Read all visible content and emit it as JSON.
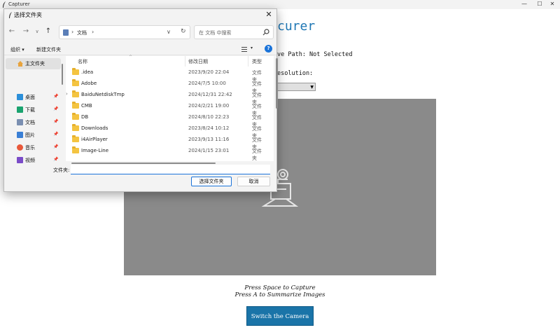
{
  "app": {
    "title": "Capturer",
    "heading_visible": "curer",
    "save_path_visible": "ve Path: Not Selected",
    "resolution_label_visible": "esolution:",
    "hint_capture": "Press Space to Capture",
    "hint_summarize": "Press A to Summarize Images",
    "switch_camera_label": "Switch the Camera",
    "controls": {
      "minimize": "—",
      "maximize": "☐",
      "close": "✕"
    },
    "accent_color": "#1a74a8",
    "camera_icon": "camera-icon"
  },
  "dialog": {
    "title": "选择文件夹",
    "close": "✕",
    "nav": {
      "back": "←",
      "forward": "→",
      "recent": "∨",
      "up": "↑"
    },
    "address": {
      "sep": "›",
      "location": "文档",
      "dropdown": "∨",
      "refresh": "↻"
    },
    "search": {
      "placeholder": "在 文档 中搜索"
    },
    "commands": {
      "organize": "组织 ▾",
      "new_folder": "新建文件夹",
      "view_drop": "▾",
      "help": "?"
    },
    "sidebar": {
      "home": "主文件夹",
      "pin": "📌",
      "items": [
        {
          "label": "桌面",
          "icon": "desktop-icon",
          "color": "#2b8fd9"
        },
        {
          "label": "下载",
          "icon": "download-icon",
          "color": "#1aa36f"
        },
        {
          "label": "文档",
          "icon": "document-icon",
          "color": "#7a8fb1"
        },
        {
          "label": "图片",
          "icon": "pictures-icon",
          "color": "#3a7fd5"
        },
        {
          "label": "音乐",
          "icon": "music-icon",
          "color": "#e8583a"
        },
        {
          "label": "视频",
          "icon": "video-icon",
          "color": "#7a4bc8"
        }
      ]
    },
    "columns": {
      "name": "名称",
      "date": "修改日期",
      "type": "类型",
      "sort": "^"
    },
    "files": [
      {
        "name": ".idea",
        "date": "2023/9/20 22:04",
        "type": "文件夹",
        "expand": ""
      },
      {
        "name": "Adobe",
        "date": "2024/7/5 10:00",
        "type": "文件夹",
        "expand": ""
      },
      {
        "name": "BaiduNetdiskTmp",
        "date": "2024/12/31 22:42",
        "type": "文件夹",
        "expand": "›"
      },
      {
        "name": "CMB",
        "date": "2024/2/21 19:00",
        "type": "文件夹",
        "expand": ""
      },
      {
        "name": "DB",
        "date": "2024/8/10 22:23",
        "type": "文件夹",
        "expand": ""
      },
      {
        "name": "Downloads",
        "date": "2023/8/24 10:12",
        "type": "文件夹",
        "expand": ""
      },
      {
        "name": "i4AirPlayer",
        "date": "2023/9/13 11:16",
        "type": "文件夹",
        "expand": ""
      },
      {
        "name": "Image-Line",
        "date": "2024/1/15 23:01",
        "type": "文件夹",
        "expand": ""
      }
    ],
    "filename_label": "文件夹:",
    "filename_value": "",
    "select_button": "选择文件夹",
    "cancel_button": "取消",
    "focus_color": "#1a73d9"
  }
}
